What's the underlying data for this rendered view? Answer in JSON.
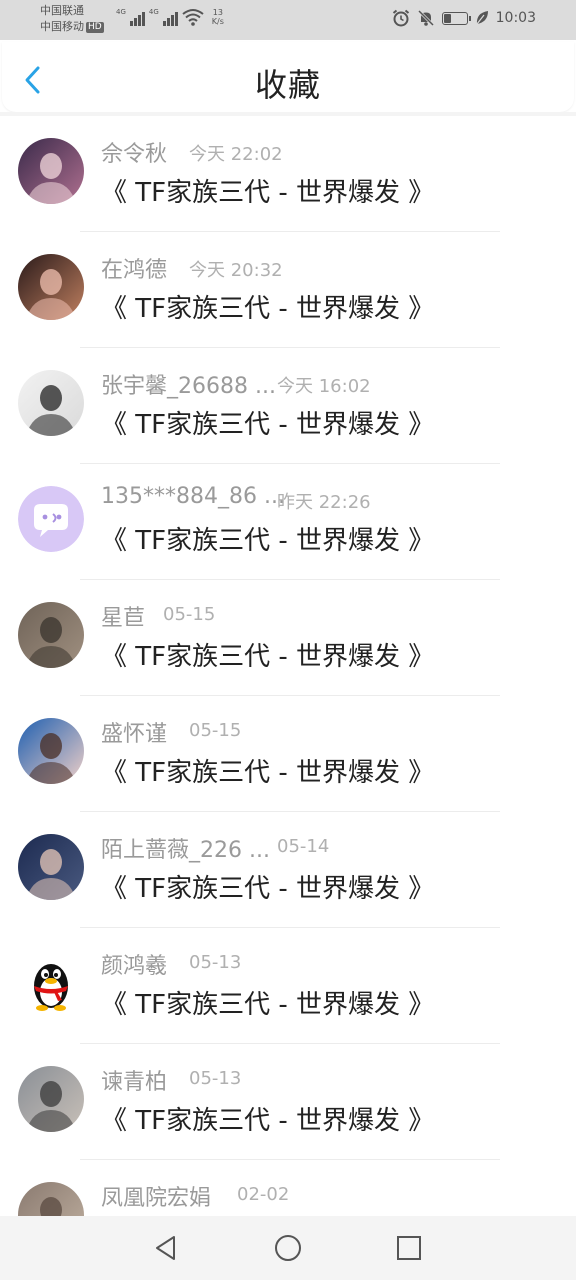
{
  "status_bar": {
    "carrier1": "中国联通",
    "carrier2": "中国移动",
    "hd_badge": "HD",
    "network1": "4G",
    "network2": "4G",
    "speed_value": "13",
    "speed_unit": "K/s",
    "time": "10:03",
    "battery_level": 0.35,
    "icons": [
      "alarm-icon",
      "mute-notification-icon",
      "battery-icon",
      "leaf-icon"
    ]
  },
  "header": {
    "title": "收藏",
    "back_icon": "chevron-left-icon",
    "accent_color": "#29a3e6"
  },
  "favorites": [
    {
      "name": "佘令秋",
      "time": "今天 22:02",
      "title": "《 TF家族三代 - 世界爆发 》",
      "avatar": "photo"
    },
    {
      "name": "在鸿德",
      "time": "今天 20:32",
      "title": "《 TF家族三代 - 世界爆发 》",
      "avatar": "photo"
    },
    {
      "name": "张宇馨_26688 ...",
      "time": "今天 16:02",
      "title": "《 TF家族三代 - 世界爆发 》",
      "avatar": "illustration"
    },
    {
      "name": "135***884_86 ...",
      "time": "昨天 22:26",
      "title": "《 TF家族三代 - 世界爆发 》",
      "avatar": "default-chat-icon"
    },
    {
      "name": "星苣",
      "time": "05-15",
      "title": "《 TF家族三代 - 世界爆发 》",
      "avatar": "cat-photo"
    },
    {
      "name": "盛怀谨",
      "time": "05-15",
      "title": "《 TF家族三代 - 世界爆发 》",
      "avatar": "photo"
    },
    {
      "name": "陌上蔷薇_226 ...",
      "time": "05-14",
      "title": "《 TF家族三代 - 世界爆发 》",
      "avatar": "photo"
    },
    {
      "name": "颜鸿羲",
      "time": "05-13",
      "title": "《 TF家族三代 - 世界爆发 》",
      "avatar": "penguin-icon"
    },
    {
      "name": "谏青柏",
      "time": "05-13",
      "title": "《 TF家族三代 - 世界爆发 》",
      "avatar": "photo"
    },
    {
      "name": "凤凰院宏娟",
      "time": "02-02",
      "title": "",
      "avatar": "photo"
    }
  ],
  "nav_bar": {
    "buttons": [
      "back-triangle-icon",
      "home-circle-icon",
      "recents-square-icon"
    ]
  }
}
